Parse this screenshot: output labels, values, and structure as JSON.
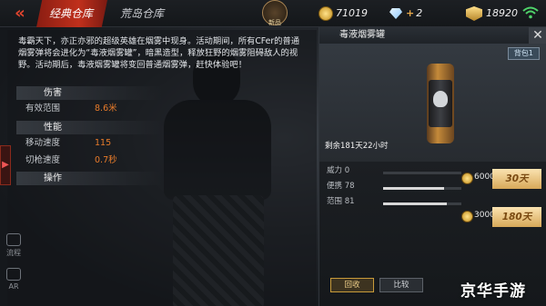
{
  "topbar": {
    "tabs": [
      {
        "label": "经典仓库",
        "active": true
      },
      {
        "label": "荒岛仓库",
        "active": false
      }
    ],
    "emblem_label": "新品",
    "coins": "71019",
    "diamonds": "2",
    "honor": "18920"
  },
  "item": {
    "description": "毒霸天下，亦正亦邪的超级英雄在烟雾中现身。活动期间，所有CFer的普通烟雾弹将会进化为“毒液烟雾罐”，暗黑造型，释放狂野的烟雾阻碍敌人的视野。活动期后，毒液烟雾罐将变回普通烟雾弹，赶快体验吧！",
    "sections": {
      "damage": "伤害",
      "performance": "性能",
      "operation": "操作"
    },
    "stats": {
      "range_label": "有效范围",
      "range_value": "8.6米",
      "move_label": "移动速度",
      "move_value": "115",
      "switch_label": "切枪速度",
      "switch_value": "0.7秒"
    }
  },
  "panel": {
    "title": "毒液烟雾罐",
    "backpack": "背包1",
    "remaining": "剩余181天22小时",
    "bars": [
      {
        "label": "威力",
        "value": 0,
        "max": 100
      },
      {
        "label": "便携",
        "value": 78,
        "max": 100
      },
      {
        "label": "范围",
        "value": 81,
        "max": 100
      }
    ],
    "prices": [
      {
        "amount": "6000",
        "duration": "30天"
      },
      {
        "amount": "30000",
        "duration": "180天"
      }
    ],
    "recycle": "回收",
    "compare": "比较"
  },
  "dock": [
    "流程",
    "AR"
  ],
  "watermark": "京华手游",
  "colors": {
    "accent": "#c0301c",
    "stat_value": "#e77b2a",
    "gold": "#d7a859"
  }
}
